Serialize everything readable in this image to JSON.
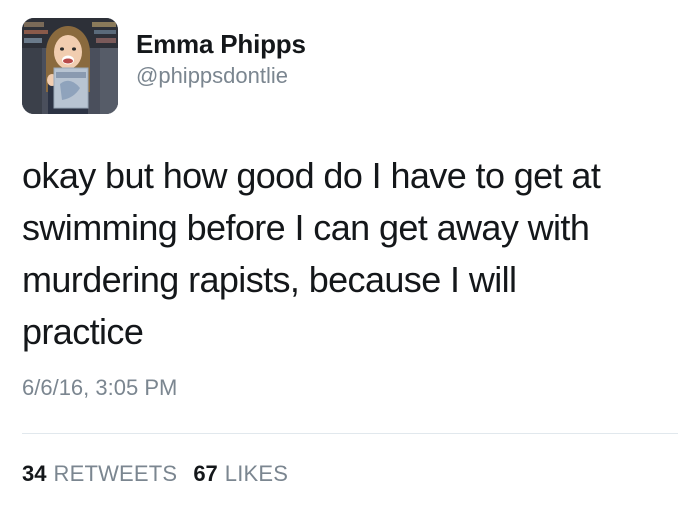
{
  "user": {
    "display_name": "Emma Phipps",
    "handle": "@phippsdontlie",
    "avatar_icon": "profile-photo"
  },
  "tweet": {
    "text": "okay but how good do I have to get at\nswimming before I can get away with\nmurdering rapists, because I will\npractice",
    "timestamp": "6/6/16, 3:05 PM"
  },
  "stats": {
    "retweets_count": "34",
    "retweets_label": "RETWEETS",
    "likes_count": "67",
    "likes_label": "LIKES"
  },
  "colors": {
    "text": "#14171a",
    "muted": "#7b8690",
    "divider": "#e1e8ed",
    "background": "#ffffff"
  }
}
